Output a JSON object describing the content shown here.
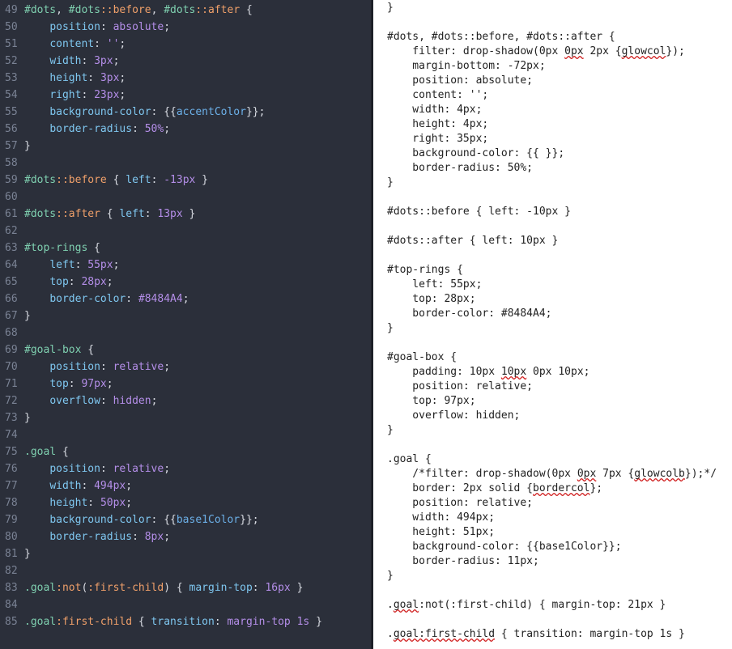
{
  "left_editor": {
    "lines": [
      {
        "n": "49",
        "tokens": [
          [
            "sel",
            "#dots"
          ],
          [
            "punc",
            ", "
          ],
          [
            "sel",
            "#dots"
          ],
          [
            "pseudo",
            "::before"
          ],
          [
            "punc",
            ", "
          ],
          [
            "sel",
            "#dots"
          ],
          [
            "pseudo",
            "::after"
          ],
          [
            "punc",
            " {"
          ]
        ]
      },
      {
        "n": "50",
        "tokens": [
          [
            "punc",
            "    "
          ],
          [
            "prop",
            "position"
          ],
          [
            "punc",
            ": "
          ],
          [
            "val",
            "absolute"
          ],
          [
            "punc",
            ";"
          ]
        ]
      },
      {
        "n": "51",
        "tokens": [
          [
            "punc",
            "    "
          ],
          [
            "prop",
            "content"
          ],
          [
            "punc",
            ": "
          ],
          [
            "val",
            "''"
          ],
          [
            "punc",
            ";"
          ]
        ]
      },
      {
        "n": "52",
        "tokens": [
          [
            "punc",
            "    "
          ],
          [
            "prop",
            "width"
          ],
          [
            "punc",
            ": "
          ],
          [
            "num",
            "3px"
          ],
          [
            "punc",
            ";"
          ]
        ]
      },
      {
        "n": "53",
        "tokens": [
          [
            "punc",
            "    "
          ],
          [
            "prop",
            "height"
          ],
          [
            "punc",
            ": "
          ],
          [
            "num",
            "3px"
          ],
          [
            "punc",
            ";"
          ]
        ]
      },
      {
        "n": "54",
        "tokens": [
          [
            "punc",
            "    "
          ],
          [
            "prop",
            "right"
          ],
          [
            "punc",
            ": "
          ],
          [
            "num",
            "23px"
          ],
          [
            "punc",
            ";"
          ]
        ]
      },
      {
        "n": "55",
        "tokens": [
          [
            "punc",
            "    "
          ],
          [
            "prop",
            "background-color"
          ],
          [
            "punc",
            ": {{"
          ],
          [
            "tmpl",
            "accentColor"
          ],
          [
            "punc",
            "}};"
          ]
        ]
      },
      {
        "n": "56",
        "tokens": [
          [
            "punc",
            "    "
          ],
          [
            "prop",
            "border-radius"
          ],
          [
            "punc",
            ": "
          ],
          [
            "num",
            "50%"
          ],
          [
            "punc",
            ";"
          ]
        ]
      },
      {
        "n": "57",
        "tokens": [
          [
            "punc",
            "}"
          ]
        ]
      },
      {
        "n": "58",
        "tokens": []
      },
      {
        "n": "59",
        "tokens": [
          [
            "sel",
            "#dots"
          ],
          [
            "pseudo",
            "::before"
          ],
          [
            "punc",
            " { "
          ],
          [
            "prop",
            "left"
          ],
          [
            "punc",
            ": "
          ],
          [
            "num",
            "-13px"
          ],
          [
            "punc",
            " }"
          ]
        ]
      },
      {
        "n": "60",
        "tokens": []
      },
      {
        "n": "61",
        "tokens": [
          [
            "sel",
            "#dots"
          ],
          [
            "pseudo",
            "::after"
          ],
          [
            "punc",
            " { "
          ],
          [
            "prop",
            "left"
          ],
          [
            "punc",
            ": "
          ],
          [
            "num",
            "13px"
          ],
          [
            "punc",
            " }"
          ]
        ]
      },
      {
        "n": "62",
        "tokens": []
      },
      {
        "n": "63",
        "tokens": [
          [
            "sel",
            "#top-rings"
          ],
          [
            "punc",
            " {"
          ]
        ]
      },
      {
        "n": "64",
        "tokens": [
          [
            "punc",
            "    "
          ],
          [
            "prop",
            "left"
          ],
          [
            "punc",
            ": "
          ],
          [
            "num",
            "55px"
          ],
          [
            "punc",
            ";"
          ]
        ]
      },
      {
        "n": "65",
        "tokens": [
          [
            "punc",
            "    "
          ],
          [
            "prop",
            "top"
          ],
          [
            "punc",
            ": "
          ],
          [
            "num",
            "28px"
          ],
          [
            "punc",
            ";"
          ]
        ]
      },
      {
        "n": "66",
        "tokens": [
          [
            "punc",
            "    "
          ],
          [
            "prop",
            "border-color"
          ],
          [
            "punc",
            ": "
          ],
          [
            "num",
            "#8484A4"
          ],
          [
            "punc",
            ";"
          ]
        ]
      },
      {
        "n": "67",
        "tokens": [
          [
            "punc",
            "}"
          ]
        ]
      },
      {
        "n": "68",
        "tokens": []
      },
      {
        "n": "69",
        "tokens": [
          [
            "sel",
            "#goal-box"
          ],
          [
            "punc",
            " {"
          ]
        ]
      },
      {
        "n": "70",
        "tokens": [
          [
            "punc",
            "    "
          ],
          [
            "prop",
            "position"
          ],
          [
            "punc",
            ": "
          ],
          [
            "val",
            "relative"
          ],
          [
            "punc",
            ";"
          ]
        ]
      },
      {
        "n": "71",
        "tokens": [
          [
            "punc",
            "    "
          ],
          [
            "prop",
            "top"
          ],
          [
            "punc",
            ": "
          ],
          [
            "num",
            "97px"
          ],
          [
            "punc",
            ";"
          ]
        ]
      },
      {
        "n": "72",
        "tokens": [
          [
            "punc",
            "    "
          ],
          [
            "prop",
            "overflow"
          ],
          [
            "punc",
            ": "
          ],
          [
            "val",
            "hidden"
          ],
          [
            "punc",
            ";"
          ]
        ]
      },
      {
        "n": "73",
        "tokens": [
          [
            "punc",
            "}"
          ]
        ]
      },
      {
        "n": "74",
        "tokens": []
      },
      {
        "n": "75",
        "tokens": [
          [
            "sel",
            ".goal"
          ],
          [
            "punc",
            " {"
          ]
        ]
      },
      {
        "n": "76",
        "tokens": [
          [
            "punc",
            "    "
          ],
          [
            "prop",
            "position"
          ],
          [
            "punc",
            ": "
          ],
          [
            "val",
            "relative"
          ],
          [
            "punc",
            ";"
          ]
        ]
      },
      {
        "n": "77",
        "tokens": [
          [
            "punc",
            "    "
          ],
          [
            "prop",
            "width"
          ],
          [
            "punc",
            ": "
          ],
          [
            "num",
            "494px"
          ],
          [
            "punc",
            ";"
          ]
        ]
      },
      {
        "n": "78",
        "tokens": [
          [
            "punc",
            "    "
          ],
          [
            "prop",
            "height"
          ],
          [
            "punc",
            ": "
          ],
          [
            "num",
            "50px"
          ],
          [
            "punc",
            ";"
          ]
        ]
      },
      {
        "n": "79",
        "tokens": [
          [
            "punc",
            "    "
          ],
          [
            "prop",
            "background-color"
          ],
          [
            "punc",
            ": {{"
          ],
          [
            "tmpl",
            "base1Color"
          ],
          [
            "punc",
            "}};"
          ]
        ]
      },
      {
        "n": "80",
        "tokens": [
          [
            "punc",
            "    "
          ],
          [
            "prop",
            "border-radius"
          ],
          [
            "punc",
            ": "
          ],
          [
            "num",
            "8px"
          ],
          [
            "punc",
            ";"
          ]
        ]
      },
      {
        "n": "81",
        "tokens": [
          [
            "punc",
            "}"
          ]
        ]
      },
      {
        "n": "82",
        "tokens": []
      },
      {
        "n": "83",
        "tokens": [
          [
            "sel",
            ".goal"
          ],
          [
            "pseudo",
            ":not"
          ],
          [
            "punc",
            "("
          ],
          [
            "pseudo",
            ":first-child"
          ],
          [
            "punc",
            ") { "
          ],
          [
            "prop",
            "margin-top"
          ],
          [
            "punc",
            ": "
          ],
          [
            "num",
            "16px"
          ],
          [
            "punc",
            " }"
          ]
        ]
      },
      {
        "n": "84",
        "tokens": []
      },
      {
        "n": "85",
        "tokens": [
          [
            "sel",
            ".goal"
          ],
          [
            "pseudo",
            ":first-child"
          ],
          [
            "punc",
            " { "
          ],
          [
            "prop",
            "transition"
          ],
          [
            "punc",
            ": "
          ],
          [
            "val",
            "margin-top"
          ],
          [
            "punc",
            " "
          ],
          [
            "num",
            "1s"
          ],
          [
            "punc",
            " }"
          ]
        ]
      }
    ]
  },
  "right_editor": {
    "lines": [
      [
        [
          "t",
          "}"
        ]
      ],
      [],
      [
        [
          "t",
          "#dots, #dots::before, #dots::after {"
        ]
      ],
      [
        [
          "t",
          "    filter: drop-shadow(0px "
        ],
        [
          "s",
          "0px"
        ],
        [
          "t",
          " 2px {"
        ],
        [
          "s",
          "glowcol"
        ],
        [
          "t",
          "});"
        ]
      ],
      [
        [
          "t",
          "    margin-bottom: -72px;"
        ]
      ],
      [
        [
          "t",
          "    position: absolute;"
        ]
      ],
      [
        [
          "t",
          "    content: '';"
        ]
      ],
      [
        [
          "t",
          "    width: 4px;"
        ]
      ],
      [
        [
          "t",
          "    height: 4px;"
        ]
      ],
      [
        [
          "t",
          "    right: 35px;"
        ]
      ],
      [
        [
          "t",
          "    background-color: {{ }};"
        ]
      ],
      [
        [
          "t",
          "    border-radius: 50%;"
        ]
      ],
      [
        [
          "t",
          "}"
        ]
      ],
      [],
      [
        [
          "t",
          "#dots::before { left: -10px }"
        ]
      ],
      [],
      [
        [
          "t",
          "#dots::after { left: 10px }"
        ]
      ],
      [],
      [
        [
          "t",
          "#top-rings {"
        ]
      ],
      [
        [
          "t",
          "    left: 55px;"
        ]
      ],
      [
        [
          "t",
          "    top: 28px;"
        ]
      ],
      [
        [
          "t",
          "    border-color: #8484A4;"
        ]
      ],
      [
        [
          "t",
          "}"
        ]
      ],
      [],
      [
        [
          "t",
          "#goal-box {"
        ]
      ],
      [
        [
          "t",
          "    padding: 10px "
        ],
        [
          "s",
          "10px"
        ],
        [
          "t",
          " 0px 10px;"
        ]
      ],
      [
        [
          "t",
          "    position: relative;"
        ]
      ],
      [
        [
          "t",
          "    top: 97px;"
        ]
      ],
      [
        [
          "t",
          "    overflow: hidden;"
        ]
      ],
      [
        [
          "t",
          "}"
        ]
      ],
      [],
      [
        [
          "t",
          ".goal {"
        ]
      ],
      [
        [
          "t",
          "    /*filter: drop-shadow(0px "
        ],
        [
          "s",
          "0px"
        ],
        [
          "t",
          " 7px {"
        ],
        [
          "s",
          "glowcolb"
        ],
        [
          "t",
          "});*/"
        ]
      ],
      [
        [
          "t",
          "    border: 2px solid {"
        ],
        [
          "s",
          "bordercol"
        ],
        [
          "t",
          "};"
        ]
      ],
      [
        [
          "t",
          "    position: relative;"
        ]
      ],
      [
        [
          "t",
          "    width: 494px;"
        ]
      ],
      [
        [
          "t",
          "    height: 51px;"
        ]
      ],
      [
        [
          "t",
          "    background-color: {{base1Color}};"
        ]
      ],
      [
        [
          "t",
          "    border-radius: 11px;"
        ]
      ],
      [
        [
          "t",
          "}"
        ]
      ],
      [],
      [
        [
          "t",
          "."
        ],
        [
          "s",
          "goal"
        ],
        [
          "t",
          ":not(:first-child) { margin-top: 21px }"
        ]
      ],
      [],
      [
        [
          "t",
          "."
        ],
        [
          "s",
          "goal:first-child"
        ],
        [
          "t",
          " { transition: margin-top 1s }"
        ]
      ]
    ]
  },
  "colors": {
    "left_bg": "#2b2f3a",
    "right_bg": "#ffffff",
    "selector": "#7fd0b0",
    "pseudo": "#f0a06a",
    "property": "#7fc7f0",
    "value": "#b48ee8",
    "template": "#6cb0e8",
    "spellcheck": "#d02020"
  }
}
